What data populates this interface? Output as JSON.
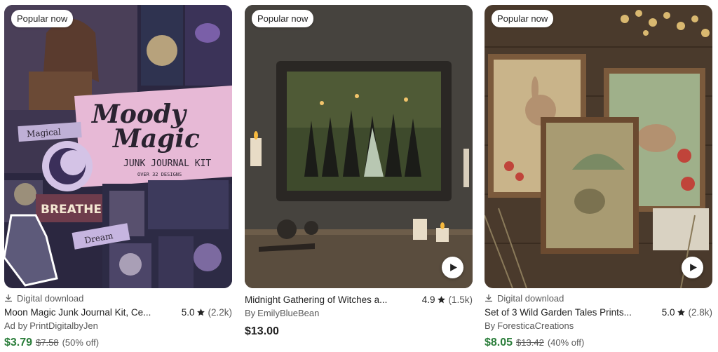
{
  "listings": [
    {
      "badge": "Popular now",
      "digital_label": "Digital download",
      "title": "Moon Magic Junk Journal Kit, Ce...",
      "rating": "5.0",
      "review_count": "(2.2k)",
      "shop_prefix": "Ad by",
      "shop_name": "PrintDigitalbyJen",
      "price": "$3.79",
      "original_price": "$7.58",
      "discount": "(50% off)",
      "image_text": {
        "line1": "Moody",
        "line2": "Magic",
        "line3": "JUNK JOURNAL KIT",
        "line4": "OVER 32 DESIGNS",
        "tag1": "Magical",
        "tag2": "BREATHE",
        "tag3": "Dream"
      },
      "has_video": false
    },
    {
      "badge": "Popular now",
      "title": "Midnight Gathering of Witches a...",
      "rating": "4.9",
      "review_count": "(1.5k)",
      "shop_prefix": "By",
      "shop_name": "EmilyBlueBean",
      "price": "$13.00",
      "has_video": true
    },
    {
      "badge": "Popular now",
      "digital_label": "Digital download",
      "title": "Set of 3 Wild Garden Tales Prints...",
      "rating": "5.0",
      "review_count": "(2.8k)",
      "shop_prefix": "By",
      "shop_name": "ForesticaCreations",
      "price": "$8.05",
      "original_price": "$13.42",
      "discount": "(40% off)",
      "has_video": true
    }
  ],
  "colors": {
    "sale_price": "#2a7d3a",
    "muted_text": "#595959",
    "text": "#222222"
  },
  "icons": {
    "digital": "download-icon",
    "rating": "star-icon",
    "video": "play-icon"
  }
}
